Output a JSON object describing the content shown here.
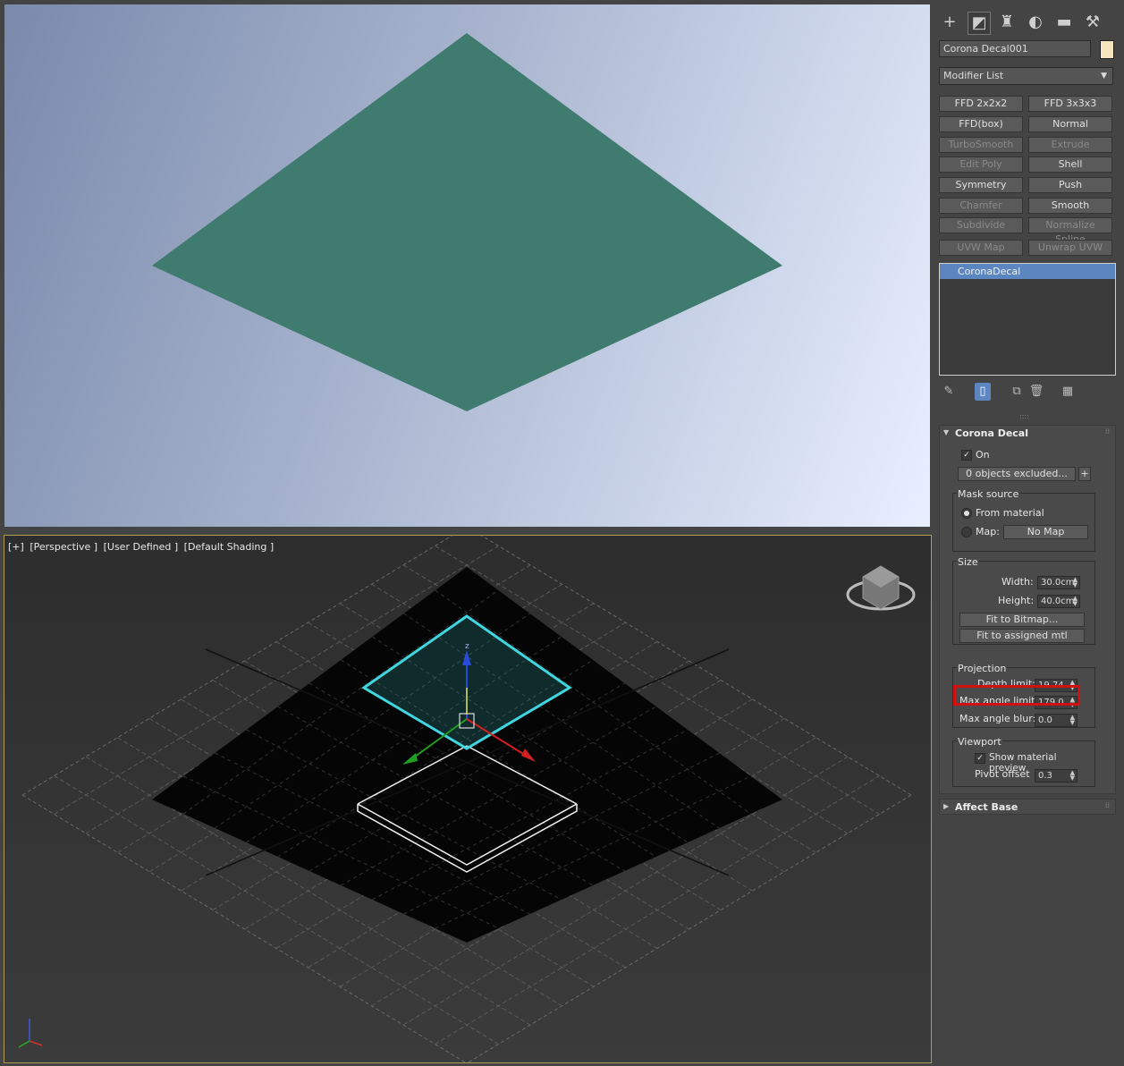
{
  "viewport_bottom": {
    "labels": [
      "[+]",
      "[Perspective ]",
      "[User Defined ]",
      "[Default Shading ]"
    ],
    "gizmo_axis": "z"
  },
  "panel": {
    "tabs": [
      "create-icon",
      "modify-icon",
      "hierarchy-icon",
      "motion-icon",
      "display-icon",
      "utilities-icon"
    ],
    "object_name": "Corona Decal001",
    "object_color": "#f5e6c0",
    "modifier_list_label": "Modifier List",
    "modifier_buttons": [
      {
        "label": "FFD 2x2x2",
        "enabled": true
      },
      {
        "label": "FFD 3x3x3",
        "enabled": true
      },
      {
        "label": "FFD(box)",
        "enabled": true
      },
      {
        "label": "Normal",
        "enabled": true
      },
      {
        "label": "TurboSmooth",
        "enabled": false
      },
      {
        "label": "Extrude",
        "enabled": false
      },
      {
        "label": "Edit Poly",
        "enabled": false
      },
      {
        "label": "Shell",
        "enabled": true
      },
      {
        "label": "Symmetry",
        "enabled": true
      },
      {
        "label": "Push",
        "enabled": true
      },
      {
        "label": "Chamfer",
        "enabled": false
      },
      {
        "label": "Smooth",
        "enabled": true
      },
      {
        "label": "Subdivide",
        "enabled": false
      },
      {
        "label": "Normalize Spline",
        "enabled": false
      },
      {
        "label": "UVW Map",
        "enabled": false
      },
      {
        "label": "Unwrap UVW",
        "enabled": false
      }
    ],
    "stack_item": "CoronaDecal",
    "corona_decal": {
      "title": "Corona Decal",
      "on_label": "On",
      "on_checked": true,
      "excluded_label": "0 objects excluded...",
      "plus_label": "+",
      "mask_source": {
        "label": "Mask source",
        "from_material": "From material",
        "map_label": "Map:",
        "map_button": "No Map"
      },
      "size": {
        "label": "Size",
        "width_label": "Width:",
        "width_value": "30.0cm",
        "height_label": "Height:",
        "height_value": "40.0cm",
        "fit_bitmap": "Fit to Bitmap...",
        "fit_mtl": "Fit to assigned mtl"
      },
      "projection": {
        "label": "Projection",
        "depth_label": "Depth limit:",
        "depth_value": "19.74",
        "max_angle_label": "Max angle limit:",
        "max_angle_value": "179.0",
        "max_blur_label": "Max angle blur:",
        "max_blur_value": "0.0"
      },
      "viewport": {
        "label": "Viewport",
        "show_preview": "Show material preview",
        "show_preview_checked": true,
        "pivot_label": "Pivot offset",
        "pivot_value": "0.3"
      }
    },
    "affect_base": {
      "title": "Affect Base"
    }
  },
  "colors": {
    "decal_green": "#3f7b6e",
    "selection_cyan": "#3fd6e0",
    "highlight_red": "#d21010",
    "stack_blue": "#5b86c0"
  }
}
